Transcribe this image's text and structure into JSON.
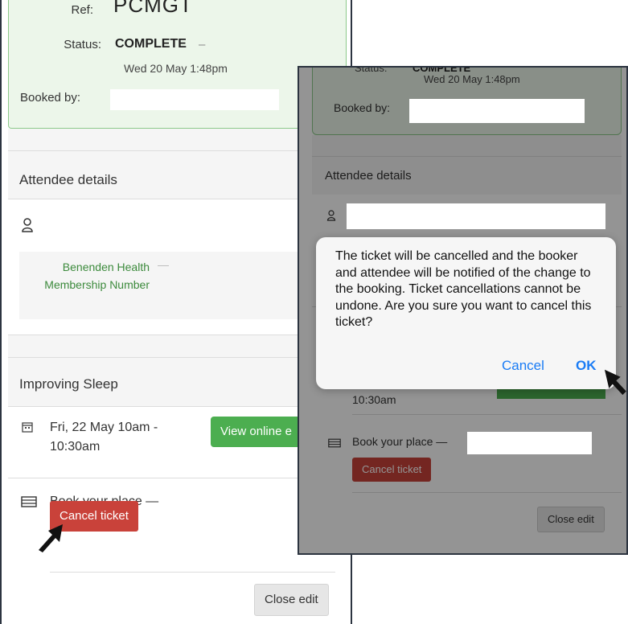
{
  "booking": {
    "ref_label": "Ref:",
    "ref_value": "PCMGT",
    "status_label": "Status:",
    "status_value": "COMPLETE",
    "status_dash": "–",
    "status_date": "Wed 20 May 1:48pm",
    "booked_by_label": "Booked by:"
  },
  "attendee": {
    "title": "Attendee details",
    "field_label": "Benenden Health Membership Number",
    "field_dash": "—"
  },
  "event": {
    "title": "Improving Sleep",
    "date_line1": "Fri, 22 May  10am -",
    "date_line2": "10:30am",
    "view_online_label": "View online e",
    "book_place_label": "Book your place —",
    "cancel_ticket_label": "Cancel ticket",
    "close_edit_label": "Close edit"
  },
  "dialog": {
    "message": "The ticket will be cancelled and the booker and attendee will be notified of the change to the booking. Ticket cancellations cannot be undone. Are you sure you want to cancel this ticket?",
    "cancel_label": "Cancel",
    "ok_label": "OK"
  },
  "right": {
    "status_partial": "COMPLETE",
    "status_label_partial": "Status:",
    "status_date": "Wed 20 May 1:48pm",
    "booked_by_label": "Booked by:",
    "attendee_title": "Attendee details",
    "time_line": "10:30am",
    "book_place_label": "Book your place —",
    "cancel_ticket_label": "Cancel ticket",
    "close_edit_label": "Close edit"
  },
  "colors": {
    "green_panel_bg": "#ecf6ea",
    "green_border": "#8cc98a",
    "green_button": "#4cae50",
    "red_button": "#c9423a",
    "link_blue": "#1a7cf5"
  },
  "icons": [
    "user-icon",
    "calendar-icon",
    "ticket-icon",
    "pointer-arrow-icon"
  ]
}
